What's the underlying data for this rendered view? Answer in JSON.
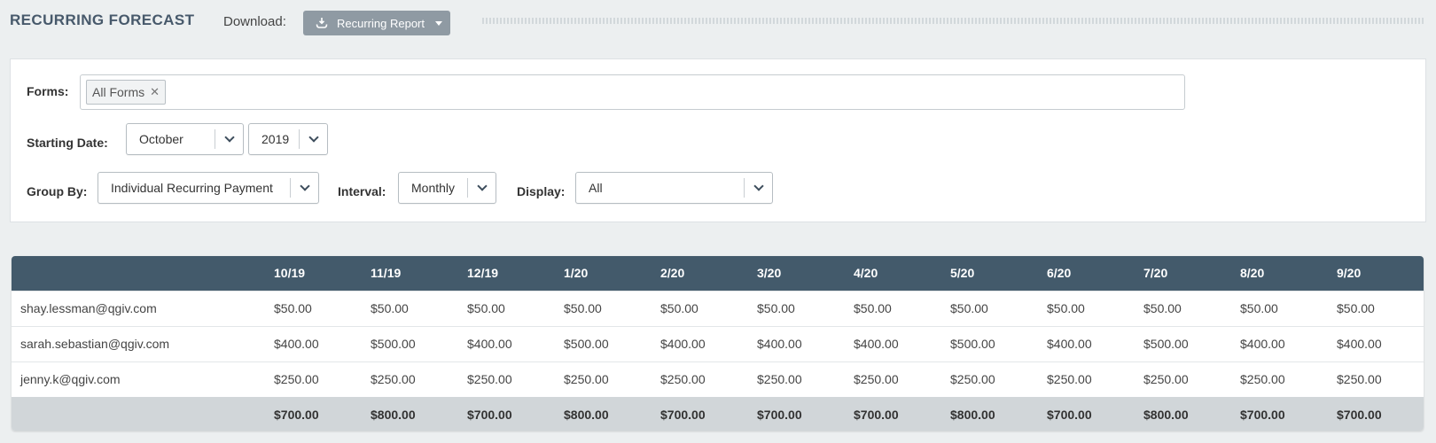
{
  "header": {
    "title": "RECURRING FORECAST",
    "download_label": "Download:",
    "report_button": "Recurring Report"
  },
  "filters": {
    "forms_label": "Forms:",
    "forms_tag": "All Forms",
    "starting_date_label": "Starting Date:",
    "month": "October",
    "year": "2019",
    "group_by_label": "Group By:",
    "group_by": "Individual Recurring Payment",
    "interval_label": "Interval:",
    "interval": "Monthly",
    "display_label": "Display:",
    "display": "All"
  },
  "table": {
    "columns": [
      "",
      "10/19",
      "11/19",
      "12/19",
      "1/20",
      "2/20",
      "3/20",
      "4/20",
      "5/20",
      "6/20",
      "7/20",
      "8/20",
      "9/20"
    ],
    "rows": [
      [
        "shay.lessman@qgiv.com",
        "$50.00",
        "$50.00",
        "$50.00",
        "$50.00",
        "$50.00",
        "$50.00",
        "$50.00",
        "$50.00",
        "$50.00",
        "$50.00",
        "$50.00",
        "$50.00"
      ],
      [
        "sarah.sebastian@qgiv.com",
        "$400.00",
        "$500.00",
        "$400.00",
        "$500.00",
        "$400.00",
        "$400.00",
        "$400.00",
        "$500.00",
        "$400.00",
        "$500.00",
        "$400.00",
        "$400.00"
      ],
      [
        "jenny.k@qgiv.com",
        "$250.00",
        "$250.00",
        "$250.00",
        "$250.00",
        "$250.00",
        "$250.00",
        "$250.00",
        "$250.00",
        "$250.00",
        "$250.00",
        "$250.00",
        "$250.00"
      ]
    ],
    "totals": [
      "",
      "$700.00",
      "$800.00",
      "$700.00",
      "$800.00",
      "$700.00",
      "$700.00",
      "$700.00",
      "$800.00",
      "$700.00",
      "$800.00",
      "$700.00",
      "$700.00"
    ]
  },
  "colors": {
    "title": "#47596b",
    "button": "#8f9aa3",
    "table_header": "#435a6b",
    "totals_row": "#d1d6d9"
  },
  "icons": {
    "download": "download-icon",
    "dropdown": "chevron-down-icon",
    "remove": "close-icon"
  }
}
